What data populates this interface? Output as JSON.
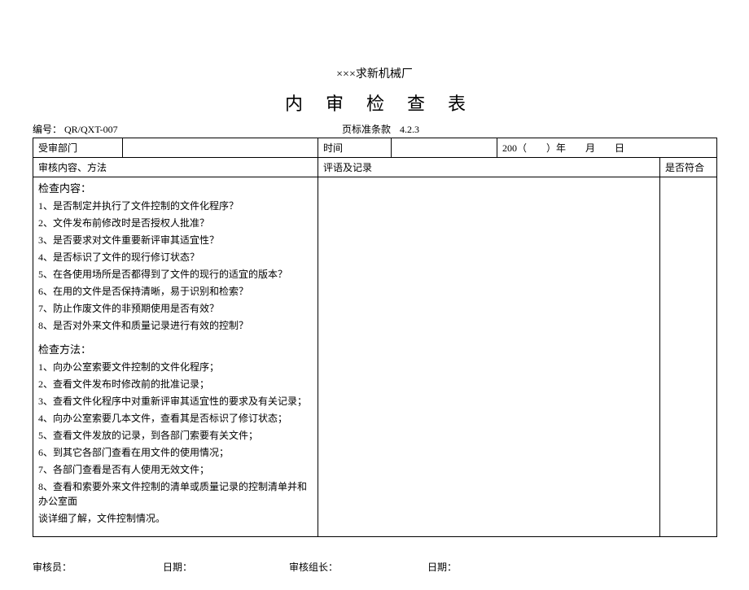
{
  "org": "×××求新机械厂",
  "title": "内审检查表",
  "code_label": "编号：",
  "code_value": "QR/QXT-007",
  "std_label": "页标准条款",
  "std_value": "4.2.3",
  "row1": {
    "dept_label": "受审部门",
    "time_label": "时间",
    "date_prefix": "200（　　）年　　月　　日"
  },
  "row2": {
    "col1": "审核内容、方法",
    "col2": "评语及记录",
    "col3": "是否符合"
  },
  "content_section_label": "检查内容：",
  "content_items": [
    "1、是否制定并执行了文件控制的文件化程序？",
    "2、文件发布前修改时是否授权人批准？",
    "3、是否要求对文件重要新评审其适宜性？",
    "4、是否标识了文件的现行修订状态？",
    "5、在各使用场所是否都得到了文件的现行的适宜的版本？",
    "6、在用的文件是否保持清晰，易于识别和检索？",
    "7、防止作废文件的非预期使用是否有效？",
    "8、是否对外来文件和质量记录进行有效的控制？"
  ],
  "method_section_label": "检查方法：",
  "method_items": [
    "1、向办公室索要文件控制的文件化程序；",
    "2、查看文件发布时修改前的批准记录；",
    "3、查看文件化程序中对重新评审其适宜性的要求及有关记录；",
    "4、向办公室索要几本文件，查看其是否标识了修订状态；",
    "5、查看文件发放的记录，到各部门索要有关文件；",
    "6、到其它各部门查看在用文件的使用情况；",
    "7、各部门查看是否有人使用无效文件；",
    "8、查看和索要外来文件控制的清单或质量记录的控制清单并和办公室面",
    "谈详细了解，文件控制情况。"
  ],
  "footer": {
    "auditor_label": "审核员：",
    "date_label": "日期：",
    "leader_label": "审核组长：",
    "date2_label": "日期："
  }
}
